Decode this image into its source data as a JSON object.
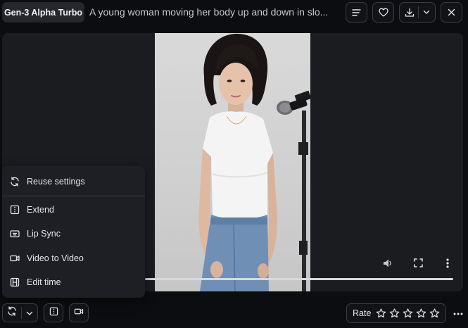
{
  "header": {
    "model_name": "Gen-3 Alpha Turbo",
    "prompt": "A young woman moving her body up and down in slo..."
  },
  "icons": {
    "details": "details-icon",
    "like": "heart-icon",
    "download": "download-icon",
    "download_menu": "chevron-down-icon",
    "close": "close-icon",
    "volume": "volume-icon",
    "fullscreen": "fullscreen-icon",
    "video_more": "more-vertical-icon",
    "reuse": "refresh-icon",
    "extend": "extend-icon",
    "lip_sync": "lip-sync-icon",
    "video_to_video": "video-camera-icon",
    "edit_time": "film-icon",
    "more": "more-horizontal-icon",
    "star": "star-outline-icon"
  },
  "menu": {
    "items": [
      {
        "label": "Reuse settings"
      },
      {
        "label": "Extend"
      },
      {
        "label": "Lip Sync"
      },
      {
        "label": "Video to Video"
      },
      {
        "label": "Edit time"
      }
    ]
  },
  "rating": {
    "label": "Rate",
    "max_stars": 5,
    "value": 0
  },
  "colors": {
    "background": "#0c0d10",
    "panel": "#1b1c20",
    "menu_bg": "#1e1f24",
    "badge_bg": "#25272c",
    "border": "#3a3d44",
    "text": "#e4e5e8"
  }
}
